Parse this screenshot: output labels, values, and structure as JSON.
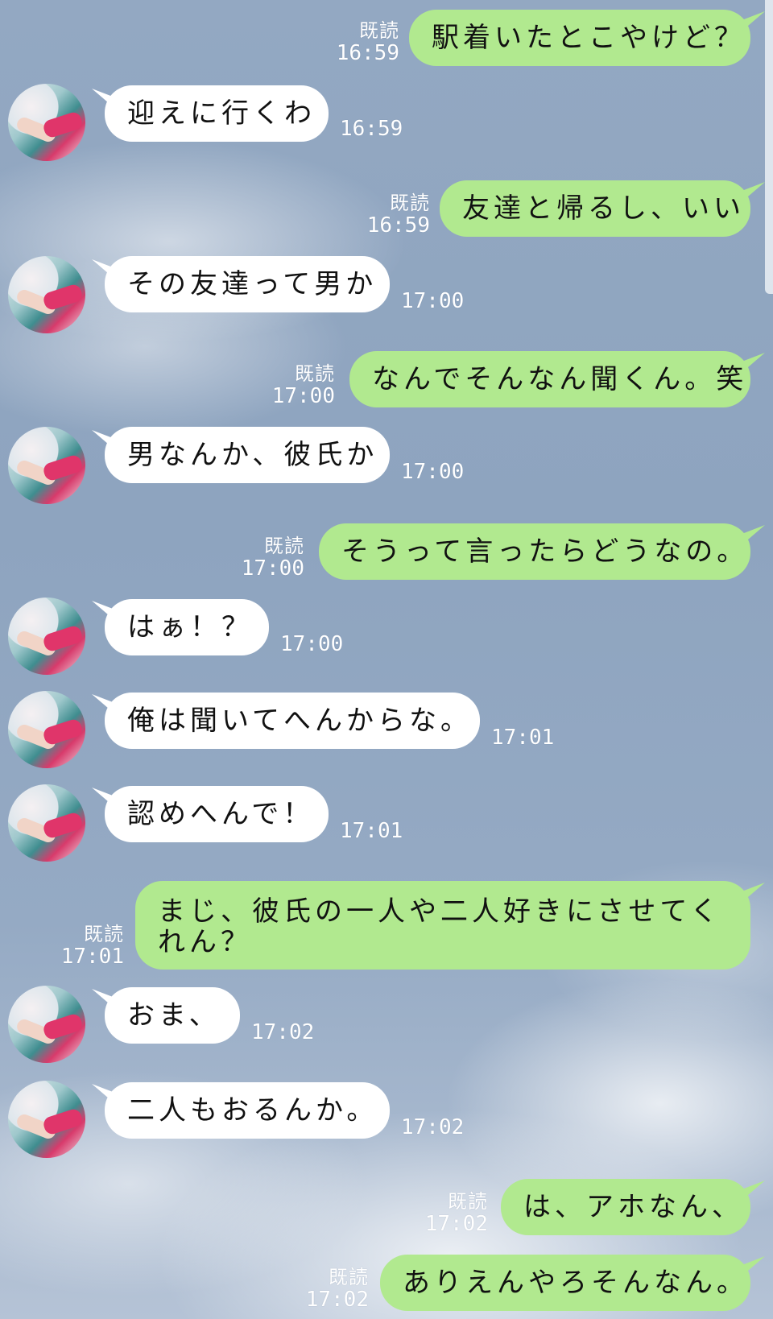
{
  "colors": {
    "incoming_bubble": "#ffffff",
    "outgoing_bubble": "#b1e98f",
    "meta_text": "#ffffff"
  },
  "avatar_icon": "user-avatar-photo",
  "messages": [
    {
      "side": "out",
      "text": "駅着いたとこやけど？",
      "read": "既読",
      "time": "16:59"
    },
    {
      "side": "in",
      "text": "迎えに行くわ",
      "time": "16:59"
    },
    {
      "side": "out",
      "text": "友達と帰るし、いい",
      "read": "既読",
      "time": "16:59"
    },
    {
      "side": "in",
      "text": "その友達って男か",
      "time": "17:00"
    },
    {
      "side": "out",
      "text": "なんでそんなん聞くん。笑",
      "read": "既読",
      "time": "17:00"
    },
    {
      "side": "in",
      "text": "男なんか、彼氏か",
      "time": "17:00"
    },
    {
      "side": "out",
      "text": "そうって言ったらどうなの。",
      "read": "既読",
      "time": "17:00"
    },
    {
      "side": "in",
      "text": "はぁ！？",
      "time": "17:00"
    },
    {
      "side": "in",
      "text": "俺は聞いてへんからな。",
      "time": "17:01"
    },
    {
      "side": "in",
      "text": "認めへんで！",
      "time": "17:01"
    },
    {
      "side": "out",
      "text": "まじ、彼氏の一人や二人好きにさせてくれん？",
      "read": "既読",
      "time": "17:01"
    },
    {
      "side": "in",
      "text": "おま、",
      "time": "17:02"
    },
    {
      "side": "in",
      "text": "二人もおるんか。",
      "time": "17:02"
    },
    {
      "side": "out",
      "text": "は、アホなん、",
      "read": "既読",
      "time": "17:02"
    },
    {
      "side": "out",
      "text": "ありえんやろそんなん。",
      "read": "既読",
      "time": "17:02"
    }
  ]
}
